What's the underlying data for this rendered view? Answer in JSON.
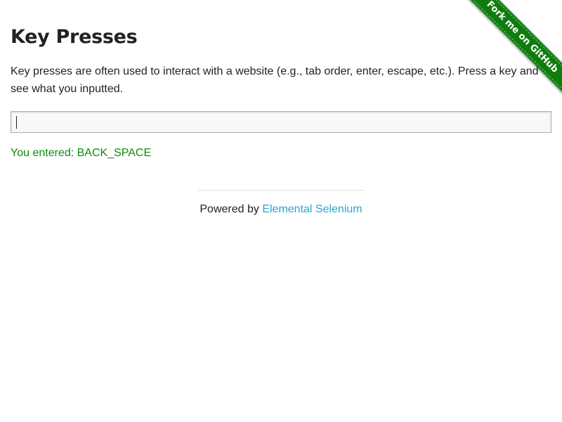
{
  "ribbon": {
    "label": "Fork me on GitHub",
    "color": "#0e7d0e"
  },
  "main": {
    "title": "Key Presses",
    "description": "Key presses are often used to interact with a website (e.g., tab order, enter, escape, etc.). Press a key and see what you inputted.",
    "input": {
      "value": "",
      "placeholder": ""
    },
    "result": "You entered: BACK_SPACE",
    "result_color": "#0f8a0f"
  },
  "footer": {
    "prefix": "Powered by ",
    "link_label": "Elemental Selenium",
    "link_color": "#2ba6cb"
  }
}
